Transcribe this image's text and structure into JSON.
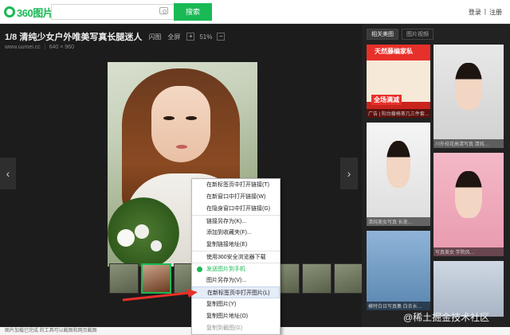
{
  "header": {
    "logo_text": "360图片",
    "search_placeholder": "",
    "search_button": "搜索",
    "login": "登录",
    "divider": "|",
    "register": "注册"
  },
  "viewer": {
    "title": "1/8 清纯少女户外唯美写真长腿迷人",
    "toolbar": {
      "flash": "闪图",
      "fullscreen": "全屏",
      "zoom_in": "+",
      "zoom_value": "51%",
      "zoom_out": "−"
    },
    "source": "www.uumei.cc ｜ 640 × 960",
    "prev": "‹",
    "next": "›"
  },
  "thumb_count": 9,
  "strip_next": "›",
  "status_text": "图片加载已完成 的工具可以截图和网页截图",
  "side_panel": {
    "tabs": [
      {
        "label": "相关美图"
      },
      {
        "label": "图片视频"
      }
    ],
    "ad": {
      "title": "天然藤编家私",
      "badge": "全场满减",
      "caption": "广告 | 阳台藤椅茶几三件套…"
    },
    "cards": [
      {
        "caption": "川外校花高清写真 清纯…"
      },
      {
        "caption": "清纯美女写真 长发…"
      },
      {
        "caption": "模特白日写真集 白衣长…"
      },
      {
        "caption": "写真美女 学院风…"
      },
      {
        "caption": ""
      }
    ]
  },
  "context_menu": {
    "items": [
      {
        "label": "在新标签页中打开链接(T)",
        "sep": false,
        "hl": false,
        "grey": false,
        "icon": false
      },
      {
        "label": "在新窗口中打开链接(W)",
        "sep": false,
        "hl": false,
        "grey": false,
        "icon": false
      },
      {
        "label": "在隐身窗口中打开链接(G)",
        "sep": false,
        "hl": false,
        "grey": false,
        "icon": false
      },
      {
        "label": "链接另存为(K)...",
        "sep": true,
        "hl": false,
        "grey": false,
        "icon": false
      },
      {
        "label": "添加到收藏夹(F)...",
        "sep": false,
        "hl": false,
        "grey": false,
        "icon": false
      },
      {
        "label": "复制链接地址(E)",
        "sep": false,
        "hl": false,
        "grey": false,
        "icon": false
      },
      {
        "label": "使用360安全浏览器下载",
        "sep": true,
        "hl": false,
        "grey": false,
        "icon": false
      },
      {
        "label": "发送图片到手机",
        "sep": true,
        "hl": false,
        "grey": false,
        "icon": true
      },
      {
        "label": "图片另存为(V)...",
        "sep": false,
        "hl": false,
        "grey": false,
        "icon": false
      },
      {
        "label": "在新标签页中打开图片(L)",
        "sep": false,
        "hl": true,
        "grey": false,
        "icon": false
      },
      {
        "label": "复制图片(Y)",
        "sep": false,
        "hl": false,
        "grey": false,
        "icon": false
      },
      {
        "label": "复制图片地址(O)",
        "sep": false,
        "hl": false,
        "grey": false,
        "icon": false
      },
      {
        "label": "复制到截图(G)",
        "sep": false,
        "hl": false,
        "grey": true,
        "icon": false
      }
    ]
  },
  "watermark": "@稀土掘金技术社区",
  "colors": {
    "accent": "#19b955",
    "arrow": "#e8302a",
    "viewer_bg": "#1c1c1c"
  },
  "icons": {
    "camera": "camera-icon",
    "menu_phone": "phone-icon",
    "arrow": "red-arrow-annotation"
  }
}
